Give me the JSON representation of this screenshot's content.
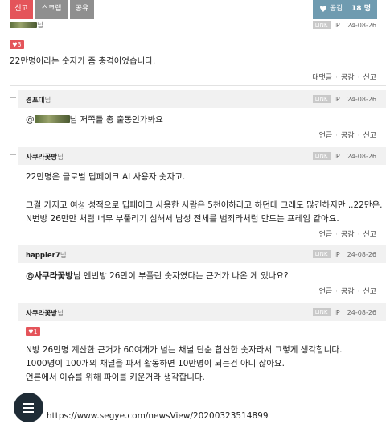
{
  "topbar": {
    "report_label": "신고",
    "scrap_label": "스크랩",
    "share_label": "공유",
    "like_label": "공감",
    "like_count": "18 명"
  },
  "comment1": {
    "nick_suffix": "님",
    "meta_date": "24-08-26",
    "link_label": "LINK",
    "ip_label": "IP",
    "badge": "♥3",
    "text": "22만명이라는 숫자가 좀 충격이었습니다.",
    "actions": [
      "대댓글",
      "공감",
      "신고"
    ]
  },
  "reply1": {
    "nick": "경포대",
    "nick_suffix": "님",
    "meta_date": "24-08-26",
    "text_prefix": "@",
    "text": "님 저쪽들 총 출동인가봐요",
    "actions": [
      "언급",
      "공감",
      "신고"
    ]
  },
  "reply2": {
    "nick": "사쿠라꽃방",
    "nick_suffix": "님",
    "meta_date": "24-08-26",
    "lines": [
      "22만명은 글로벌 딥페이크 AI 사용자 숫자고.",
      "그걸 가지고 여성 성적으로 딥페이크 사용한 사람은 5천이하라고 하던데 그래도 많긴하지만 ..22만은.",
      "N번방 26만만 처럼 너무 부풀리기 심해서 남성 전체를 범죄라처럼 만드는 프레임 같아요."
    ],
    "actions": [
      "언급",
      "공감",
      "신고"
    ]
  },
  "reply3": {
    "nick": "happier7",
    "nick_suffix": "님",
    "meta_date": "24-08-26",
    "mention": "@사쿠라꽃방",
    "text": "님 엔번방 26만이 부풀린 숫자였다는 근거가 나온 게 있나요?",
    "actions": [
      "언급",
      "공감",
      "신고"
    ]
  },
  "reply4": {
    "nick": "사쿠라꽃방",
    "nick_suffix": "님",
    "meta_date": "24-08-26",
    "badge": "♥1",
    "lines": [
      "N방 26만명 계산한 근거가 60여개가 넘는 채널 단순 합산한 숫자라서 그렇게 생각합니다.",
      "1000명이 100개의 채널을 파서 활동하면 10만명이 되는건 아니 잖아요.",
      "언론에서 이슈를 위해 파이를 키운거라 생각합니다."
    ],
    "url": "https://www.segye.com/newsView/20200323514899"
  },
  "icons": {
    "heart": "heart-icon",
    "menu": "hamburger-menu-icon"
  },
  "colors": {
    "red": "#e4545a",
    "gray_button": "#8f8f8f",
    "like_button": "#6f9bb0",
    "fab": "#1f2c36"
  }
}
